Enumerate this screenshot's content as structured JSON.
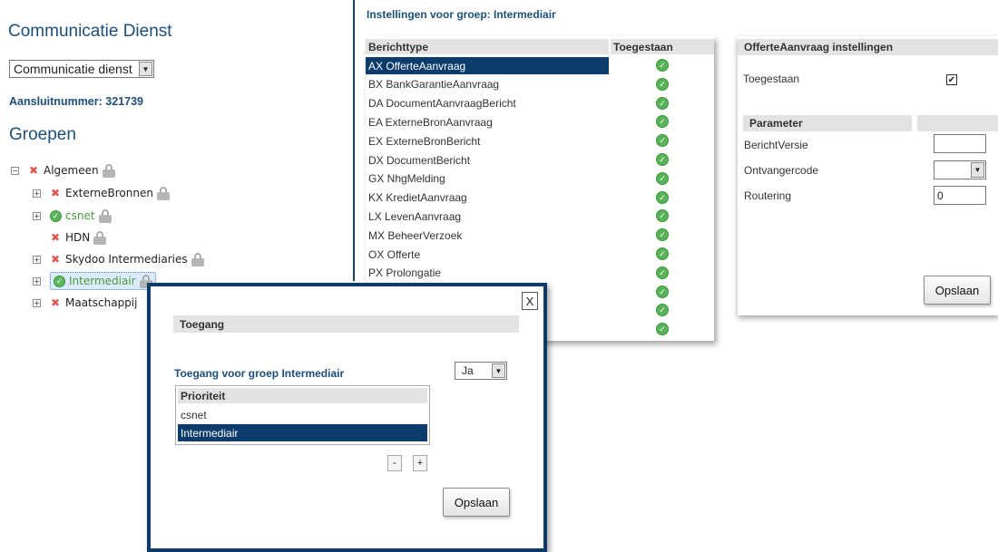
{
  "left": {
    "title": "Communicatie Dienst",
    "service_select": {
      "value": "Communicatie dienst"
    },
    "aansluitnummer": "Aansluitnummer: 321739",
    "groups_title": "Groepen",
    "tree": [
      {
        "label": "Algemeen",
        "expander": "−",
        "status": "x",
        "locked": true
      },
      {
        "label": "ExterneBronnen",
        "expander": "+",
        "status": "x",
        "locked": true
      },
      {
        "label": "csnet",
        "expander": "+",
        "status": "ok",
        "locked": true
      },
      {
        "label": "HDN",
        "expander": "",
        "status": "x",
        "locked": true
      },
      {
        "label": "Skydoo Intermediaries",
        "expander": "+",
        "status": "x",
        "locked": true
      },
      {
        "label": "Intermediair",
        "expander": "+",
        "status": "ok",
        "locked": true,
        "selected": true
      },
      {
        "label": "Maatschappij",
        "expander": "+",
        "status": "x",
        "locked": true
      }
    ]
  },
  "group_settings": {
    "header": "Instellingen voor groep: Intermediair",
    "columns": [
      "Berichttype",
      "Toegestaan"
    ],
    "rows": [
      {
        "label": "AX OfferteAanvraag",
        "allowed": true,
        "selected": true
      },
      {
        "label": "BX BankGarantieAanvraag",
        "allowed": true
      },
      {
        "label": "DA DocumentAanvraagBericht",
        "allowed": true
      },
      {
        "label": "EA ExterneBronAanvraag",
        "allowed": true
      },
      {
        "label": "EX ExterneBronBericht",
        "allowed": true
      },
      {
        "label": "DX DocumentBericht",
        "allowed": true
      },
      {
        "label": "GX NhgMelding",
        "allowed": true
      },
      {
        "label": "KX KredietAanvraag",
        "allowed": true
      },
      {
        "label": "LX LevenAanvraag",
        "allowed": true
      },
      {
        "label": "MX BeheerVerzoek",
        "allowed": true
      },
      {
        "label": "OX Offerte",
        "allowed": true
      },
      {
        "label": "PX Prolongatie",
        "allowed": true
      },
      {
        "label": "",
        "allowed": true
      },
      {
        "label": "",
        "allowed": true
      },
      {
        "label": "",
        "allowed": true
      }
    ],
    "check_glyph": "✓"
  },
  "message_settings": {
    "header": "OfferteAanvraag instellingen",
    "allowed_label": "Toegestaan",
    "allowed_checked": "✔",
    "param_header": "Parameter",
    "params": {
      "berichtversie_label": "BerichtVersie",
      "berichtversie_value": "",
      "ontvangercode_label": "Ontvangercode",
      "ontvangercode_value": "",
      "routering_label": "Routering",
      "routering_value": "0"
    },
    "save_label": "Opslaan"
  },
  "dialog": {
    "close_label": "X",
    "section_title": "Toegang",
    "access_label": "Toegang voor groep Intermediair",
    "access_value": "Ja",
    "priority_header": "Prioriteit",
    "priority_items": [
      {
        "label": "csnet",
        "selected": false
      },
      {
        "label": "Intermediair",
        "selected": true
      }
    ],
    "minus_label": "-",
    "plus_label": "+",
    "save_label": "Opslaan"
  },
  "icons": {
    "x_mark": "✖",
    "ok_mark": "✓",
    "dropdown": "▼"
  },
  "colors": {
    "accent": "#1c4f7a",
    "selection": "#0b3c6b",
    "ok_green": "#58b258",
    "x_red": "#e0554f"
  }
}
